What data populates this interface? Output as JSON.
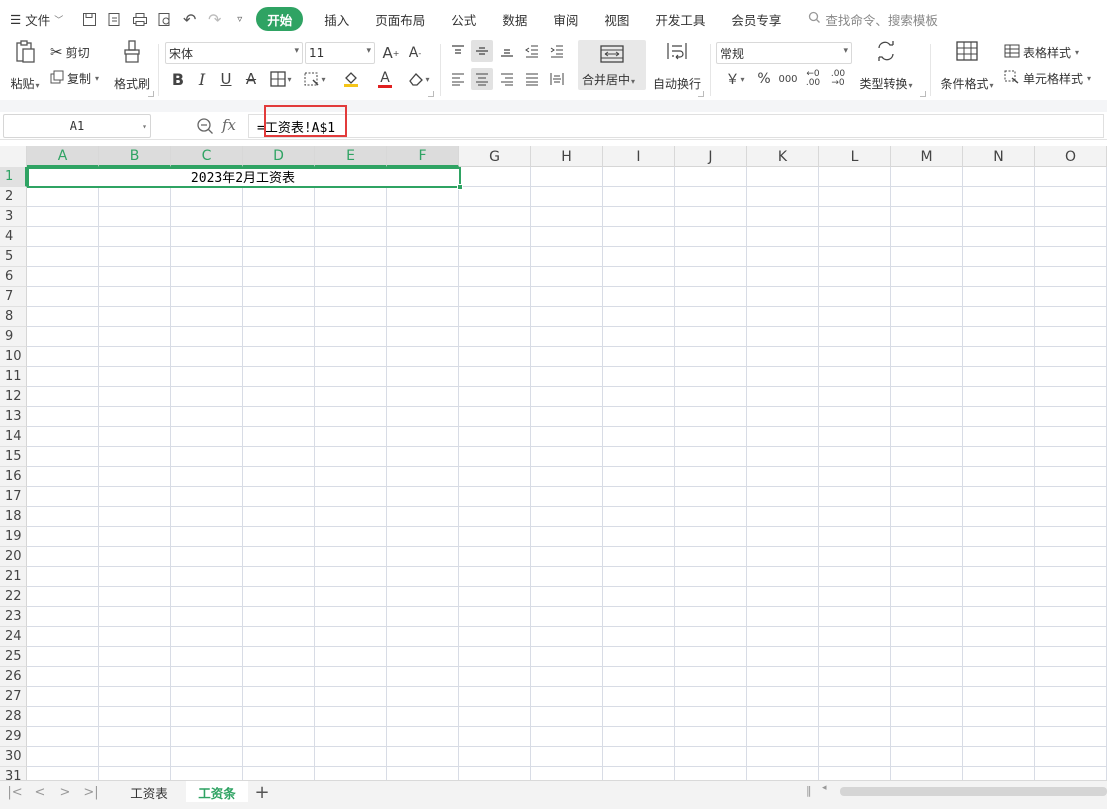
{
  "menubar": {
    "file_label": "文件",
    "tabs": [
      "开始",
      "插入",
      "页面布局",
      "公式",
      "数据",
      "审阅",
      "视图",
      "开发工具",
      "会员专享"
    ],
    "active_tab": "开始",
    "search_placeholder": "查找命令、搜索模板"
  },
  "ribbon": {
    "paste": "粘贴",
    "cut": "剪切",
    "copy": "复制",
    "format_painter": "格式刷",
    "font_name": "宋体",
    "font_size": "11",
    "merge_center": "合并居中",
    "wrap_text": "自动换行",
    "number_format": "常规",
    "type_convert": "类型转换",
    "conditional_format": "条件格式",
    "table_style": "表格样式",
    "cell_style": "单元格样式",
    "currency_symbol": "￥",
    "percent_symbol": "%",
    "thousands_symbol": "000",
    "font_color": "#e02020",
    "fill_color": "#f5c518"
  },
  "formula_bar": {
    "name_box": "A1",
    "fx_label": "fx",
    "formula": "=工资表!A$1"
  },
  "sheet": {
    "columns": [
      "A",
      "B",
      "C",
      "D",
      "E",
      "F",
      "G",
      "H",
      "I",
      "J",
      "K",
      "L",
      "M",
      "N",
      "O"
    ],
    "selected_columns": [
      "A",
      "B",
      "C",
      "D",
      "E",
      "F"
    ],
    "row_count": 31,
    "selected_row": 1,
    "title_cell_text": "2023年2月工资表",
    "accent_color": "#2fa363"
  },
  "tabs": {
    "sheets": [
      "工资表",
      "工资条"
    ],
    "active_sheet": "工资条",
    "add_sheet": "+"
  }
}
